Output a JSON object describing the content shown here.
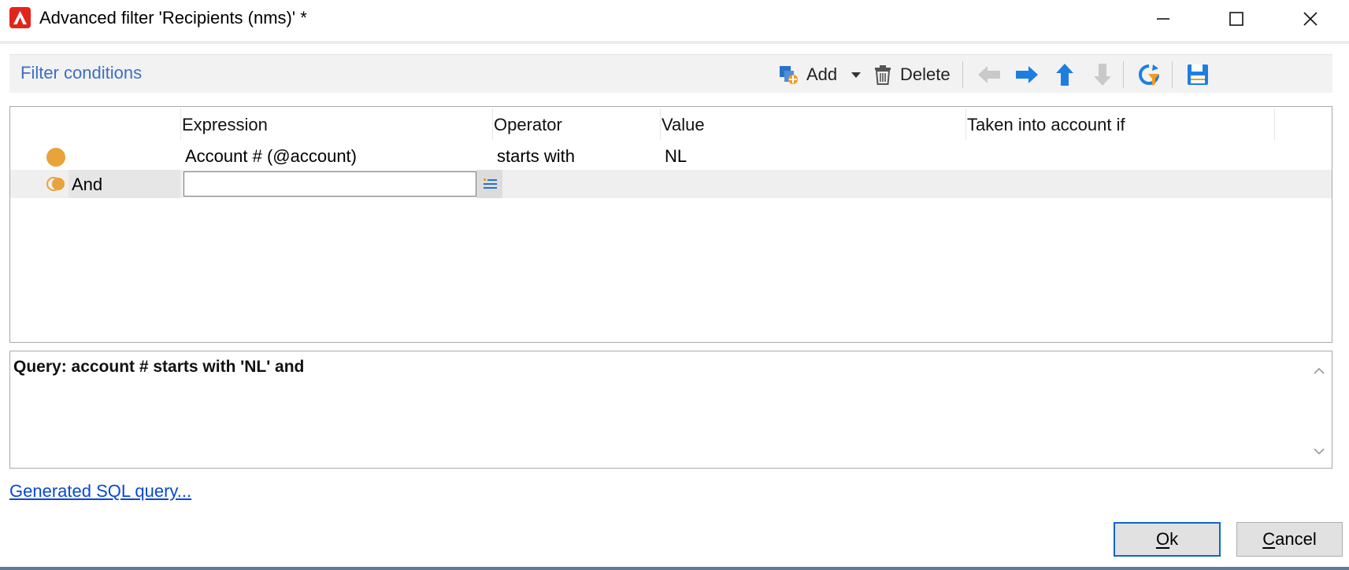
{
  "window": {
    "title": "Advanced filter 'Recipients (nms)' *",
    "accent": "#e1251b"
  },
  "toolbar": {
    "section_label": "Filter conditions",
    "add_label": "Add",
    "delete_label": "Delete"
  },
  "grid": {
    "columns": [
      "Expression",
      "Operator",
      "Value",
      "Taken into account if"
    ],
    "rows": [
      {
        "expression": "Account # (@account)",
        "operator": "starts with",
        "value": "NL"
      },
      {
        "logic": "And",
        "expression": ""
      }
    ]
  },
  "query": {
    "text": "Query: account # starts with 'NL' and"
  },
  "links": {
    "sql": "Generated SQL query..."
  },
  "buttons": {
    "ok_prefix": "O",
    "ok_rest": "k",
    "cancel_prefix": "C",
    "cancel_rest": "ancel"
  },
  "colors": {
    "link": "#0a47d6",
    "section_label": "#3b6fc6",
    "condition_dot": "#e8a33a",
    "arrow_blue": "#1e7ee0"
  }
}
